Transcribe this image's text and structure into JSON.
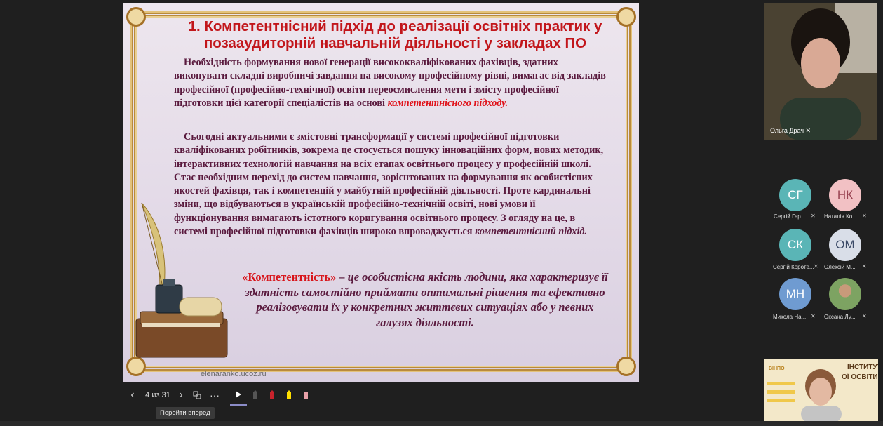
{
  "slide": {
    "title": "1. Компетентнісний підхід до реалізації освітніх практик у позааудиторній навчальній діяльності у закладах ПО",
    "p1_text": "Необхідність формування нової генерації висококваліфікованих фахівців, здатних виконувати складні виробничі завдання на високому професійному рівні, вимагає від закладів професійної (професійно-технічної) освіти переосмислення мети і змісту професійної підготовки цієї категорії спеціалістів на основі",
    "p1_highlight": "компетентнісного підходу.",
    "p2_text": "Сьогодні  актуальними є змістовні трансформації у системі професійної підготовки кваліфікованих робітників, зокрема це стосується пошуку інноваційних форм, нових методик, інтерактивних технологій навчання на всіх етапах освітнього процесу у професійній школі. Стає необхідним перехід до систем навчання, зорієнтованих на формування як особистісних якостей фахівця, так і компетенцій у майбутній професійній діяльності. Проте кардинальні зміни, що відбуваються в українській професійно-технічній освіті, нові умови її функціонування вимагають істотного коригування освітнього процесу. З огляду на це, в системі професійної підготовки фахівців широко впроваджується",
    "p2_end": "компетентнісний підхід.",
    "def_keyword": "«Компетентність»",
    "def_text": " – це особистісна якість людини, яка характеризує її здатність самостійно приймати оптимальні рішення та ефективно реалізовувати їх у конкретних життєвих ситуаціях або у певних галузях діяльності.",
    "watermark": "elenaranko.ucoz.ru"
  },
  "toolbar": {
    "page_counter": "4 из 31",
    "tooltip": "Перейти вперед"
  },
  "participants": {
    "main_video_name": "Ольга Драч",
    "list": [
      {
        "initials": "СГ",
        "name": "Сергій Гер...",
        "color": "#5ab5b6"
      },
      {
        "initials": "НК",
        "name": "Наталія Ко...",
        "color": "#f2c1c4",
        "text_color": "#9b4654"
      },
      {
        "initials": "СК",
        "name": "Сергій Короте...",
        "color": "#5ab5b6"
      },
      {
        "initials": "ОМ",
        "name": "Олексій М...",
        "color": "#d9dee8",
        "text_color": "#3b4a67"
      },
      {
        "initials": "МН",
        "name": "Микола На...",
        "color": "#6f9bd1"
      },
      {
        "initials": "",
        "name": "Оксана Лу...",
        "color": "#7da362"
      }
    ]
  },
  "screen_share": {
    "line1": "ІНСТИТУТ",
    "line2": "ОЇ ОСВІТИ",
    "logo": "ВІНПО"
  },
  "colors": {
    "title_red": "#c2161b",
    "body_purple": "#5a1a3e",
    "frame_gold": "#b98a3c"
  }
}
